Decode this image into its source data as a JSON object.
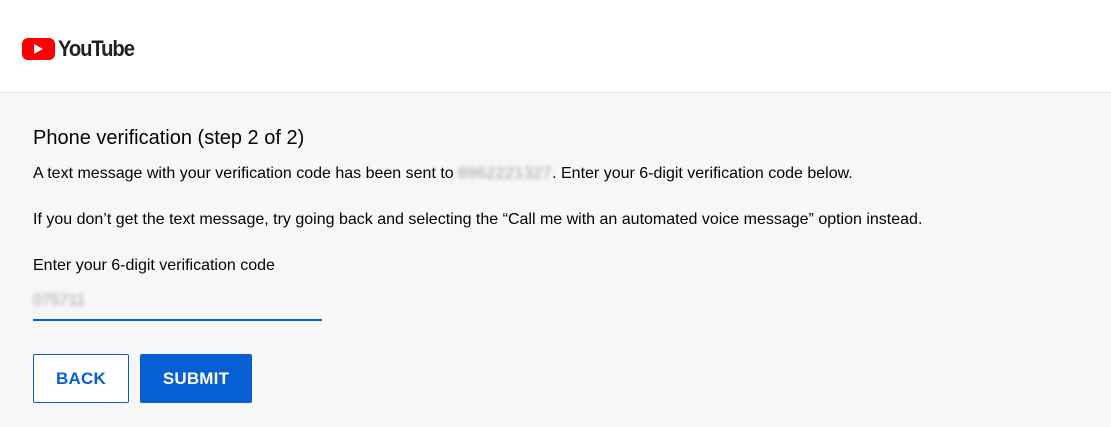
{
  "header": {
    "brand": "YouTube"
  },
  "verification": {
    "title": "Phone verification (step 2 of 2)",
    "sent_prefix": "A text message with your verification code has been sent to ",
    "phone_number": "8962221327",
    "sent_suffix": ". Enter your 6-digit verification code below.",
    "fallback_text": "If you don’t get the text message, try going back and selecting the “Call me with an automated voice message” option instead.",
    "code_label": "Enter your 6-digit verification code",
    "code_value": "075711",
    "back_label": "BACK",
    "submit_label": "SUBMIT"
  },
  "colors": {
    "accent": "#065fd4",
    "brand_red": "#ff0000",
    "page_background": "#f7f7f7"
  },
  "icons": {
    "logo": "youtube-play-icon"
  }
}
